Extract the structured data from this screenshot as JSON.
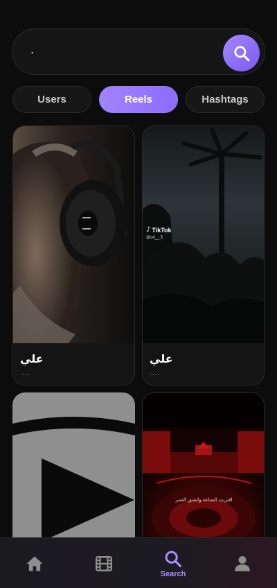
{
  "search": {
    "value": ".",
    "icon": "search-icon",
    "accent": "#8f70fb"
  },
  "tabs": [
    {
      "label": "Users",
      "active": false
    },
    {
      "label": "Reels",
      "active": true
    },
    {
      "label": "Hashtags",
      "active": false
    }
  ],
  "reels": [
    {
      "title": "علي",
      "subtitle": "....",
      "thumbnail": "man-with-headphones"
    },
    {
      "title": "علي",
      "subtitle": "....",
      "thumbnail": "palm-trees-night",
      "watermark": "TikTok",
      "watermark_handle": "@c4__.5"
    },
    {
      "title": "",
      "subtitle": "",
      "thumbnail": "video-placeholder-play"
    },
    {
      "title": "",
      "subtitle": "",
      "thumbnail": "red-shrine",
      "overlay_text": "اقتربت الساعة وانشق القمر"
    }
  ],
  "bottom_nav": {
    "items": [
      {
        "name": "home",
        "icon": "home-icon",
        "label": ""
      },
      {
        "name": "reels",
        "icon": "film-icon",
        "label": ""
      },
      {
        "name": "search",
        "icon": "search-icon",
        "label": "Search",
        "active": true
      },
      {
        "name": "profile",
        "icon": "person-icon",
        "label": ""
      }
    ],
    "active_color": "#a98cff",
    "inactive_color": "#8e8e8e"
  }
}
